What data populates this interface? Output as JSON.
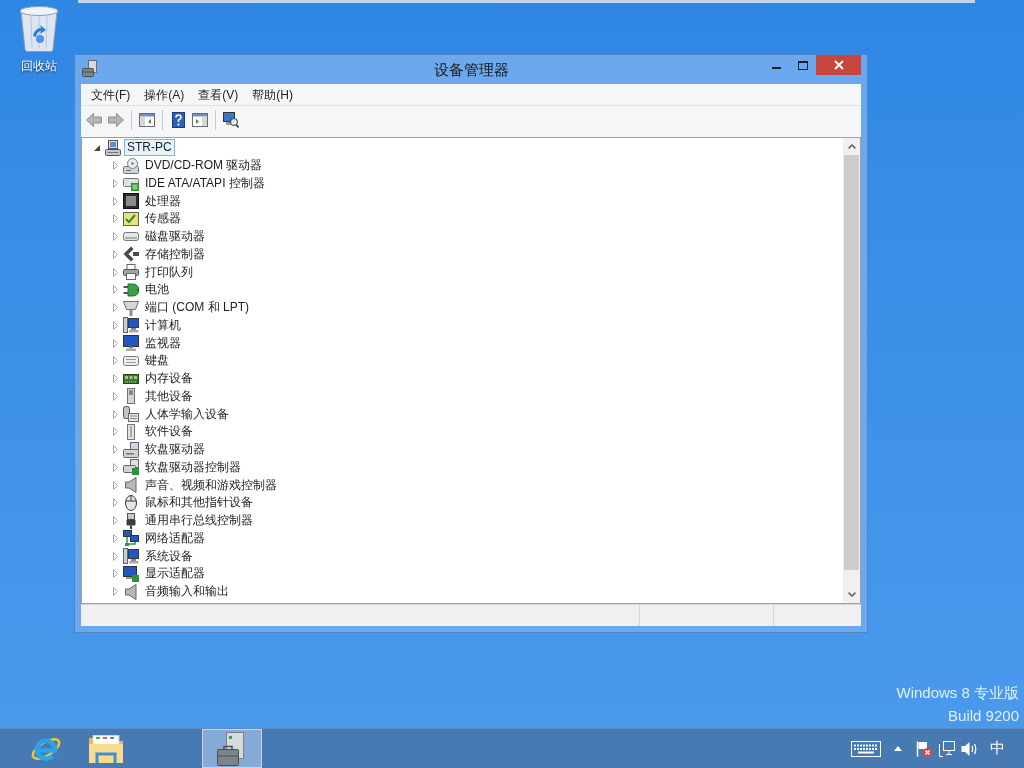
{
  "desktop": {
    "icons": [
      {
        "label": "回收站"
      }
    ],
    "edition": "Windows 8 专业版",
    "build": "Build 9200"
  },
  "window": {
    "title": "设备管理器",
    "menu": [
      "文件(F)",
      "操作(A)",
      "查看(V)",
      "帮助(H)"
    ],
    "toolbar": [
      {
        "kind": "back",
        "disabled": true
      },
      {
        "kind": "forward",
        "disabled": true
      },
      {
        "kind": "separator"
      },
      {
        "kind": "console-tree"
      },
      {
        "kind": "separator"
      },
      {
        "kind": "help"
      },
      {
        "kind": "action-pane"
      },
      {
        "kind": "separator"
      },
      {
        "kind": "scan"
      }
    ],
    "tree": {
      "label": "STR-PC",
      "expanded": true,
      "selected": true,
      "children": [
        {
          "label": "DVD/CD-ROM 驱动器",
          "expanded": false,
          "selected": false
        },
        {
          "label": "IDE ATA/ATAPI 控制器",
          "expanded": false,
          "selected": false
        },
        {
          "label": "处理器",
          "expanded": false,
          "selected": false
        },
        {
          "label": "传感器",
          "expanded": false,
          "selected": false
        },
        {
          "label": "磁盘驱动器",
          "expanded": false,
          "selected": false
        },
        {
          "label": "存储控制器",
          "expanded": false,
          "selected": false
        },
        {
          "label": "打印队列",
          "expanded": false,
          "selected": false
        },
        {
          "label": "电池",
          "expanded": false,
          "selected": false
        },
        {
          "label": "端口 (COM 和 LPT)",
          "expanded": false,
          "selected": false
        },
        {
          "label": "计算机",
          "expanded": false,
          "selected": false
        },
        {
          "label": "监视器",
          "expanded": false,
          "selected": false
        },
        {
          "label": "键盘",
          "expanded": false,
          "selected": false
        },
        {
          "label": "内存设备",
          "expanded": false,
          "selected": false
        },
        {
          "label": "其他设备",
          "expanded": false,
          "selected": false
        },
        {
          "label": "人体学输入设备",
          "expanded": false,
          "selected": false
        },
        {
          "label": "软件设备",
          "expanded": false,
          "selected": false
        },
        {
          "label": "软盘驱动器",
          "expanded": false,
          "selected": false
        },
        {
          "label": "软盘驱动器控制器",
          "expanded": false,
          "selected": false
        },
        {
          "label": "声音、视频和游戏控制器",
          "expanded": false,
          "selected": false
        },
        {
          "label": "鼠标和其他指针设备",
          "expanded": false,
          "selected": false
        },
        {
          "label": "通用串行总线控制器",
          "expanded": false,
          "selected": false
        },
        {
          "label": "网络适配器",
          "expanded": false,
          "selected": false
        },
        {
          "label": "系统设备",
          "expanded": false,
          "selected": false
        },
        {
          "label": "显示适配器",
          "expanded": false,
          "selected": false
        },
        {
          "label": "音频输入和输出",
          "expanded": false,
          "selected": false
        }
      ]
    }
  },
  "taskbar": {
    "apps": [
      {
        "selected": false
      },
      {
        "selected": false
      },
      {
        "selected": true
      }
    ],
    "tray": {
      "ime": "中"
    }
  }
}
